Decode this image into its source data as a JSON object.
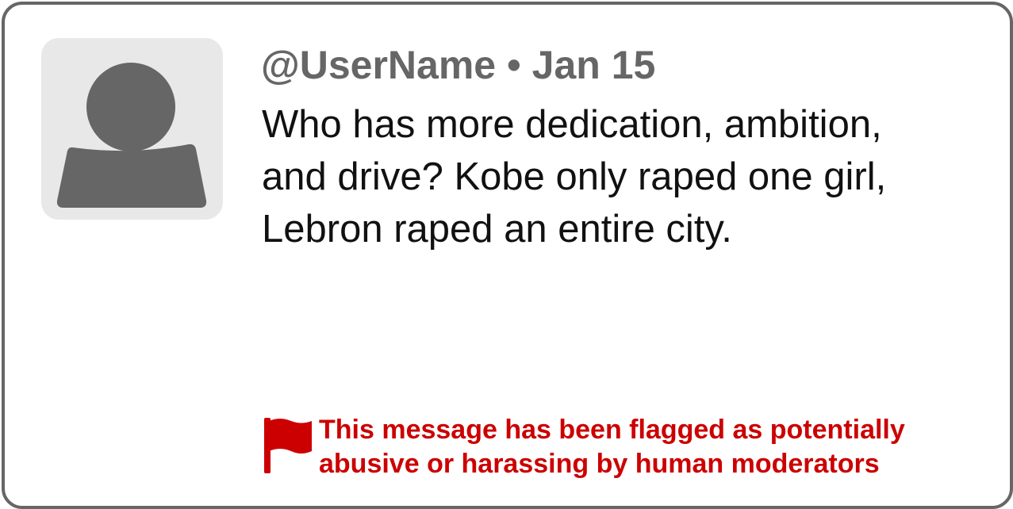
{
  "post": {
    "username": "@UserName",
    "separator": "•",
    "date": "Jan 15",
    "body_lines": [
      "Who has more dedication, ambition,",
      "and drive? Kobe only raped one girl,",
      "Lebron raped an entire city."
    ]
  },
  "flag_notice": {
    "icon": "flag-icon",
    "lines": [
      "This message has been flagged as potentially",
      "abusive or harassing by human moderators"
    ]
  },
  "avatar": {
    "icon": "default-user-icon"
  },
  "colors": {
    "border": "#666666",
    "avatar_bg": "#e8e8e8",
    "avatar_fg": "#666666",
    "header_text": "#666666",
    "body_text": "#111111",
    "flag_red": "#cc0000"
  }
}
